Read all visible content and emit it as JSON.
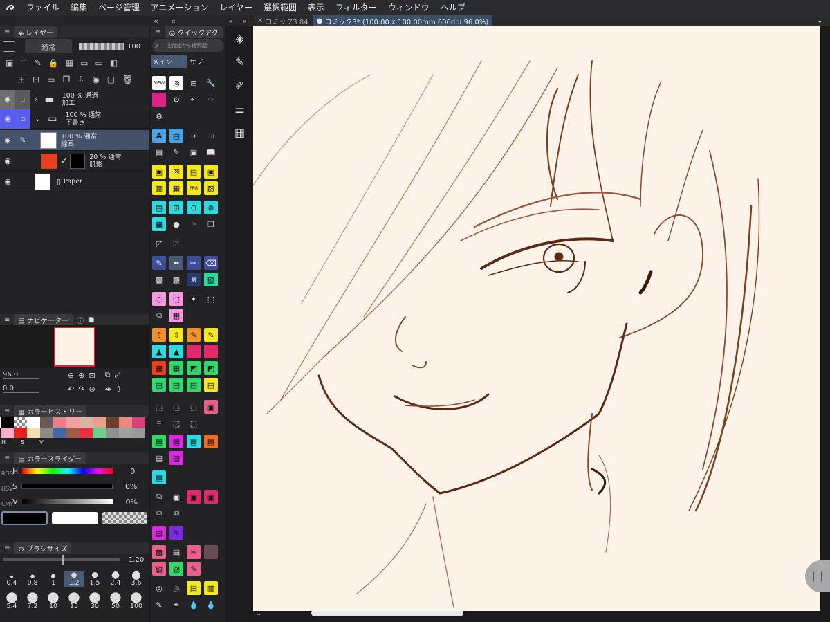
{
  "menu": [
    "ファイル",
    "編集",
    "ページ管理",
    "アニメーション",
    "レイヤー",
    "選択範囲",
    "表示",
    "フィルター",
    "ウィンドウ",
    "ヘルプ"
  ],
  "tabs": [
    "コミック3 84",
    "コミック3* (100.00 x 100.00mm 600dpi 96.0%)"
  ],
  "panel_layers": {
    "title": "レイヤー",
    "blend": "通常",
    "opacity": "100"
  },
  "layers": [
    {
      "pct": "100 %",
      "mode": "通過",
      "name": "加工"
    },
    {
      "pct": "100 %",
      "mode": "通常",
      "name": "下書き"
    },
    {
      "pct": "100 %",
      "mode": "通常",
      "name": "線画"
    },
    {
      "pct": "20 %",
      "mode": "通常",
      "name": "肌影"
    },
    {
      "pct": "",
      "mode": "",
      "name": "Paper"
    }
  ],
  "quick": {
    "title": "クイックアク",
    "search": "全階組から検索(図",
    "tab_main": "メイン",
    "tab_sub": "サブ"
  },
  "navigator": {
    "title": "ナビゲーター",
    "zoom": "96.0",
    "rotate": "0.0"
  },
  "history": {
    "title": "カラーヒストリー",
    "labels": [
      "H",
      "S",
      "V"
    ]
  },
  "slider": {
    "title": "カラースライダー",
    "h": "H",
    "s": "S",
    "v": "V",
    "hval": "0",
    "sval": "0%",
    "vval": "0%",
    "modes": [
      "RGB",
      "HSV",
      "CMY"
    ]
  },
  "brush": {
    "title": "ブラシサイズ",
    "value": "1.20",
    "sizes_row1": [
      "0.4",
      "0.8",
      "1",
      "1.2",
      "1.5",
      "2.4",
      "3.6"
    ],
    "sizes_row2": [
      "5.4",
      "7.2",
      "10",
      "15",
      "30",
      "50",
      "100"
    ]
  },
  "colors": {
    "accent": "#5a5cf0",
    "canvas": "#fdf3e8",
    "stroke": "#7a3f1e"
  }
}
